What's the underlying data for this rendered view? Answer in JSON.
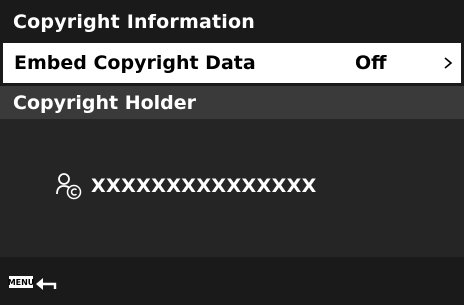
{
  "header": {
    "title": "Copyright Information"
  },
  "menu": {
    "items": [
      {
        "label": "Embed Copyright Data",
        "value": "Off",
        "icon": "chevron-right-icon"
      },
      {
        "label": "Copyright Holder"
      }
    ]
  },
  "holder": {
    "icon": "person-copyright-icon",
    "value": "XXXXXXXXXXXXXXX"
  },
  "footer": {
    "menu_button": "MENU",
    "back_icon": "back-arrow-icon"
  },
  "colors": {
    "background": "#1a1a1a",
    "selected_row": "#ffffff",
    "holder_row": "#3a3a3a",
    "content_area": "#252525"
  }
}
